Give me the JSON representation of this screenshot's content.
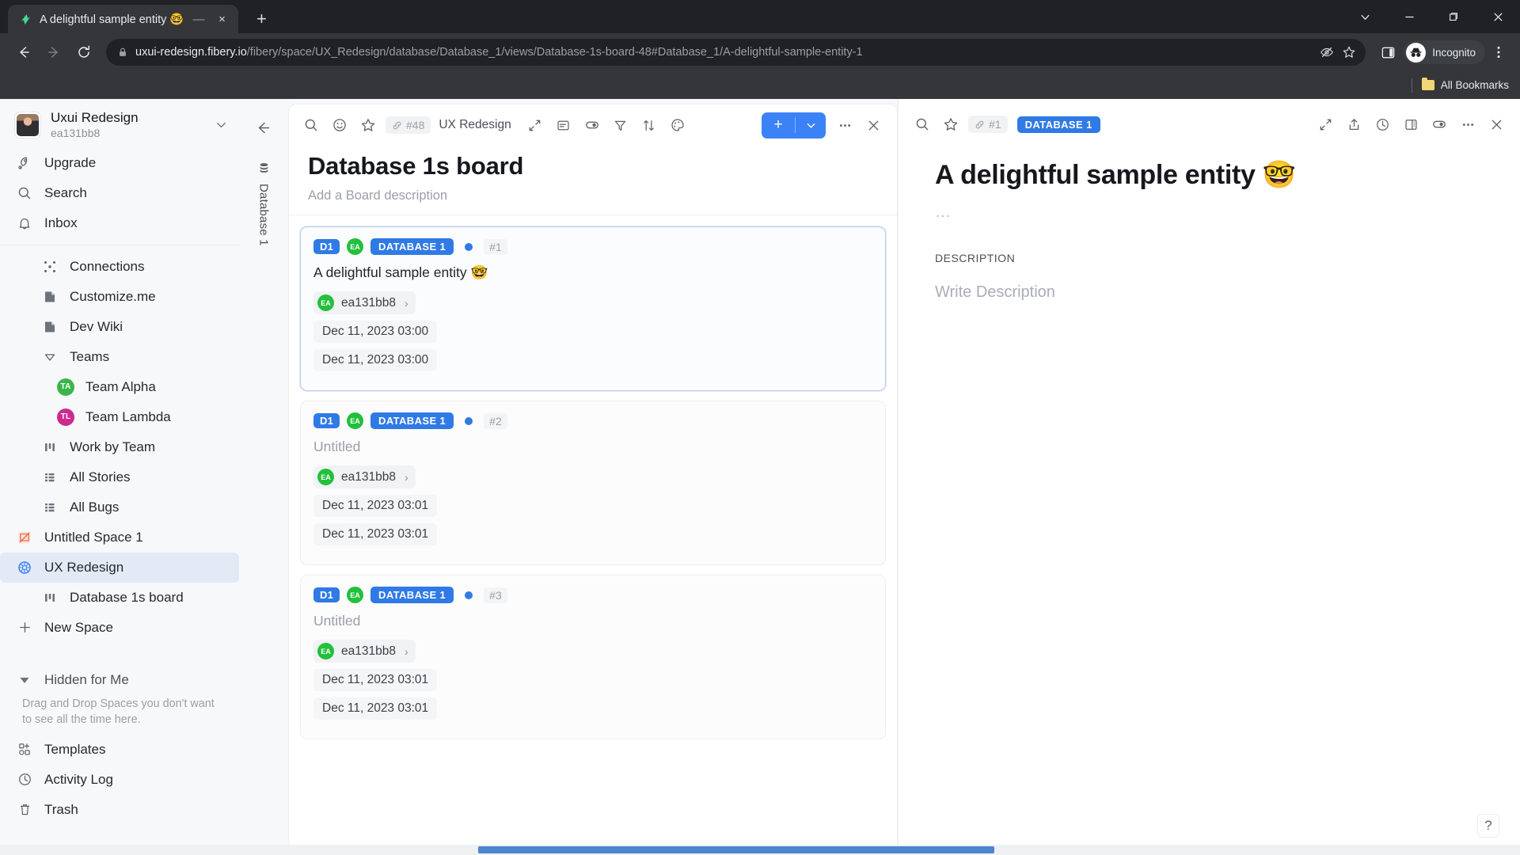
{
  "browser": {
    "tab": {
      "title": "A delightful sample entity 🤓",
      "favicon": "fibery-logo-icon",
      "close": "×"
    },
    "new_tab_label": "+",
    "window_controls": [
      "chevron-down-icon",
      "minimize-icon",
      "restore-icon",
      "close-icon"
    ],
    "nav": {
      "back": "←",
      "forward": "→",
      "reload": "⟳"
    },
    "omnibox": {
      "lock": "lock-icon",
      "domain": "uxui-redesign.fibery.io",
      "path": "/fibery/space/UX_Redesign/database/Database_1/views/Database-1s-board-48#Database_1/A-delightful-sample-entity-1",
      "third_party_cookie": "eye-slash-icon",
      "bookmark": "star-icon"
    },
    "profile": {
      "label": "Incognito",
      "icon": "incognito-icon"
    },
    "side_panel": "side-panel-icon",
    "menu": "three-dot-menu-icon",
    "bookmarks": {
      "label": "All Bookmarks",
      "icon": "folder-icon"
    }
  },
  "sidebar": {
    "workspace": {
      "name": "Uxui Redesign",
      "user": "ea131bb8",
      "caret": "chevron-down-icon"
    },
    "top_items": [
      {
        "label": "Upgrade",
        "icon": "rocket-icon"
      },
      {
        "label": "Search",
        "icon": "search-icon"
      },
      {
        "label": "Inbox",
        "icon": "bell-icon"
      }
    ],
    "spaces": [
      {
        "label": "Connections",
        "icon": "connections-icon",
        "indent": 1
      },
      {
        "label": "Customize.me",
        "icon": "doc-icon",
        "indent": 1
      },
      {
        "label": "Dev Wiki",
        "icon": "doc-icon",
        "indent": 1
      },
      {
        "label": "Teams",
        "icon": "chevron-collapse-icon",
        "indent": 1
      },
      {
        "label": "Team Alpha",
        "icon": "avatar-ta",
        "initials": "TA",
        "color": "#3bb54a",
        "indent": 2
      },
      {
        "label": "Team Lambda",
        "icon": "avatar-tl",
        "initials": "TL",
        "color": "#cc2a8f",
        "indent": 2
      },
      {
        "label": "Work by Team",
        "icon": "board-icon",
        "indent": 1
      },
      {
        "label": "All Stories",
        "icon": "grid-icon",
        "indent": 1
      },
      {
        "label": "All Bugs",
        "icon": "grid-icon",
        "indent": 1
      },
      {
        "label": "Untitled Space 1",
        "icon": "space-icon",
        "indent": 0
      },
      {
        "label": "UX Redesign",
        "icon": "brain-icon",
        "indent": 0,
        "selected": true
      },
      {
        "label": "Database 1s board",
        "icon": "board-icon",
        "indent": 1
      },
      {
        "label": "New Space",
        "icon": "plus-icon",
        "indent": 0
      }
    ],
    "hidden": {
      "label": "Hidden for Me",
      "icon": "chevron-expand-icon",
      "hint": "Drag and Drop Spaces you don't want to see all the time here."
    },
    "bottom_items": [
      {
        "label": "Templates",
        "icon": "templates-icon"
      },
      {
        "label": "Activity Log",
        "icon": "clock-icon"
      },
      {
        "label": "Trash",
        "icon": "trash-icon"
      }
    ]
  },
  "board": {
    "rail": {
      "icon": "database-icon",
      "label": "Database 1"
    },
    "back": "arrow-left-icon",
    "toolbar": {
      "search": "search-icon",
      "emoji": "smiley-icon",
      "favorite": "star-icon",
      "ref_label": "#48",
      "ref_icon": "link-icon",
      "space_name": "UX Redesign",
      "expand": "expand-icon",
      "layout": "layout-icon",
      "visibility": "toggle-icon",
      "filter": "filter-icon",
      "sort": "sort-icon",
      "palette": "palette-icon",
      "add_label": "+",
      "add_chevron": "chevron-down-icon",
      "more": "three-dot-menu-icon",
      "close": "close-icon"
    },
    "title": "Database 1s board",
    "description_placeholder": "Add a Board description",
    "cards": [
      {
        "tag_d1": "D1",
        "tag_avatar": "EA",
        "tag_db": "DATABASE 1",
        "number": "#1",
        "title": "A delightful sample entity 🤓",
        "title_muted": false,
        "owner": "ea131bb8",
        "owner_initials": "EA",
        "date_created": "Dec 11, 2023 03:00",
        "date_modified": "Dec 11, 2023 03:00",
        "active": true
      },
      {
        "tag_d1": "D1",
        "tag_avatar": "EA",
        "tag_db": "DATABASE 1",
        "number": "#2",
        "title": "Untitled",
        "title_muted": true,
        "owner": "ea131bb8",
        "owner_initials": "EA",
        "date_created": "Dec 11, 2023 03:01",
        "date_modified": "Dec 11, 2023 03:01",
        "active": false
      },
      {
        "tag_d1": "D1",
        "tag_avatar": "EA",
        "tag_db": "DATABASE 1",
        "number": "#3",
        "title": "Untitled",
        "title_muted": true,
        "owner": "ea131bb8",
        "owner_initials": "EA",
        "date_created": "Dec 11, 2023 03:01",
        "date_modified": "Dec 11, 2023 03:01",
        "active": false
      }
    ]
  },
  "detail": {
    "toolbar": {
      "search": "search-icon",
      "favorite": "star-icon",
      "ref_icon": "link-icon",
      "ref_label": "#1",
      "db_badge": "DATABASE 1",
      "expand": "expand-icon",
      "share": "share-icon",
      "history": "clock-icon",
      "panel": "split-panel-icon",
      "visibility": "toggle-icon",
      "more": "three-dot-menu-icon",
      "close": "close-icon"
    },
    "title": "A delightful sample entity 🤓",
    "dots": "…",
    "description_label": "DESCRIPTION",
    "description_placeholder": "Write Description",
    "help_label": "?"
  },
  "colors": {
    "accent_blue": "#2f7ae5",
    "add_button": "#3b82f6",
    "green_avatar": "#22c03c",
    "selected_nav": "#e3eaf6",
    "scrollbar": "#4b86ce"
  }
}
